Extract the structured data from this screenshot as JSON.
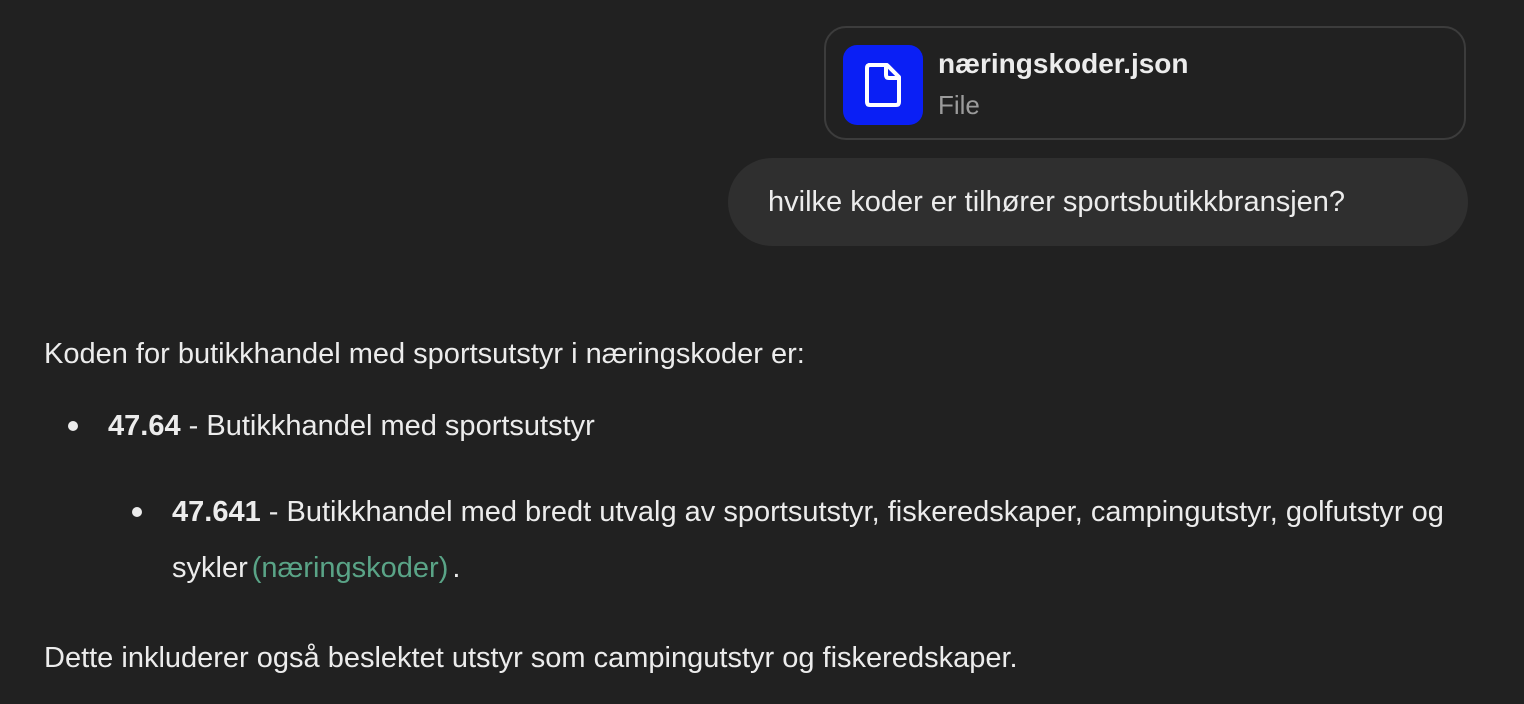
{
  "attachment": {
    "file_name": "næringskoder.json",
    "file_type": "File",
    "icon": "document-icon",
    "icon_bg_color": "#0a1ff5"
  },
  "user_message": {
    "text": "hvilke koder er tilhører sportsbutikkbransjen?"
  },
  "assistant_response": {
    "intro": "Koden for butikkhandel med sportsutstyr i næringskoder er:",
    "items": [
      {
        "code": "47.64",
        "description": " - Butikkhandel med sportsutstyr"
      },
      {
        "code": "47.641",
        "description": " - Butikkhandel med bredt utvalg av sportsutstyr, fiskeredskaper, campingutstyr, golfutstyr og sykler",
        "source_label": "(næringskoder)",
        "trailing": "."
      }
    ],
    "outro": "Dette inkluderer også beslektet utstyr som campingutstyr og fiskeredskaper."
  },
  "colors": {
    "background": "#212121",
    "user_bubble": "#2f2f2f",
    "link": "#5aa487"
  }
}
